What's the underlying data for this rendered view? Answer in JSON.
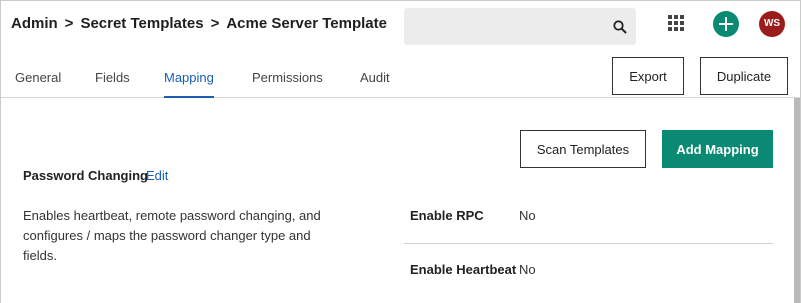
{
  "breadcrumb": {
    "items": [
      "Admin",
      "Secret Templates",
      "Acme Server Template"
    ],
    "separator": ">"
  },
  "search": {
    "placeholder": "",
    "value": ""
  },
  "header": {
    "avatar_initials": "WS",
    "accent_color": "#0a8a73",
    "avatar_color": "#9b1c1c"
  },
  "tabs": [
    {
      "label": "General",
      "active": false
    },
    {
      "label": "Fields",
      "active": false
    },
    {
      "label": "Mapping",
      "active": true
    },
    {
      "label": "Permissions",
      "active": false
    },
    {
      "label": "Audit",
      "active": false
    }
  ],
  "actions": {
    "export_label": "Export",
    "duplicate_label": "Duplicate"
  },
  "mapping": {
    "scan_label": "Scan Templates",
    "add_label": "Add Mapping",
    "section_title": "Password Changing",
    "edit_label": "Edit",
    "description": "Enables heartbeat, remote password changing, and configures / maps the password changer type and fields.",
    "fields": [
      {
        "label": "Enable RPC",
        "value": "No"
      },
      {
        "label": "Enable Heartbeat",
        "value": "No"
      }
    ]
  },
  "icons": {
    "search": "search-icon",
    "apps": "apps-grid-icon",
    "add": "add-circle-icon"
  }
}
